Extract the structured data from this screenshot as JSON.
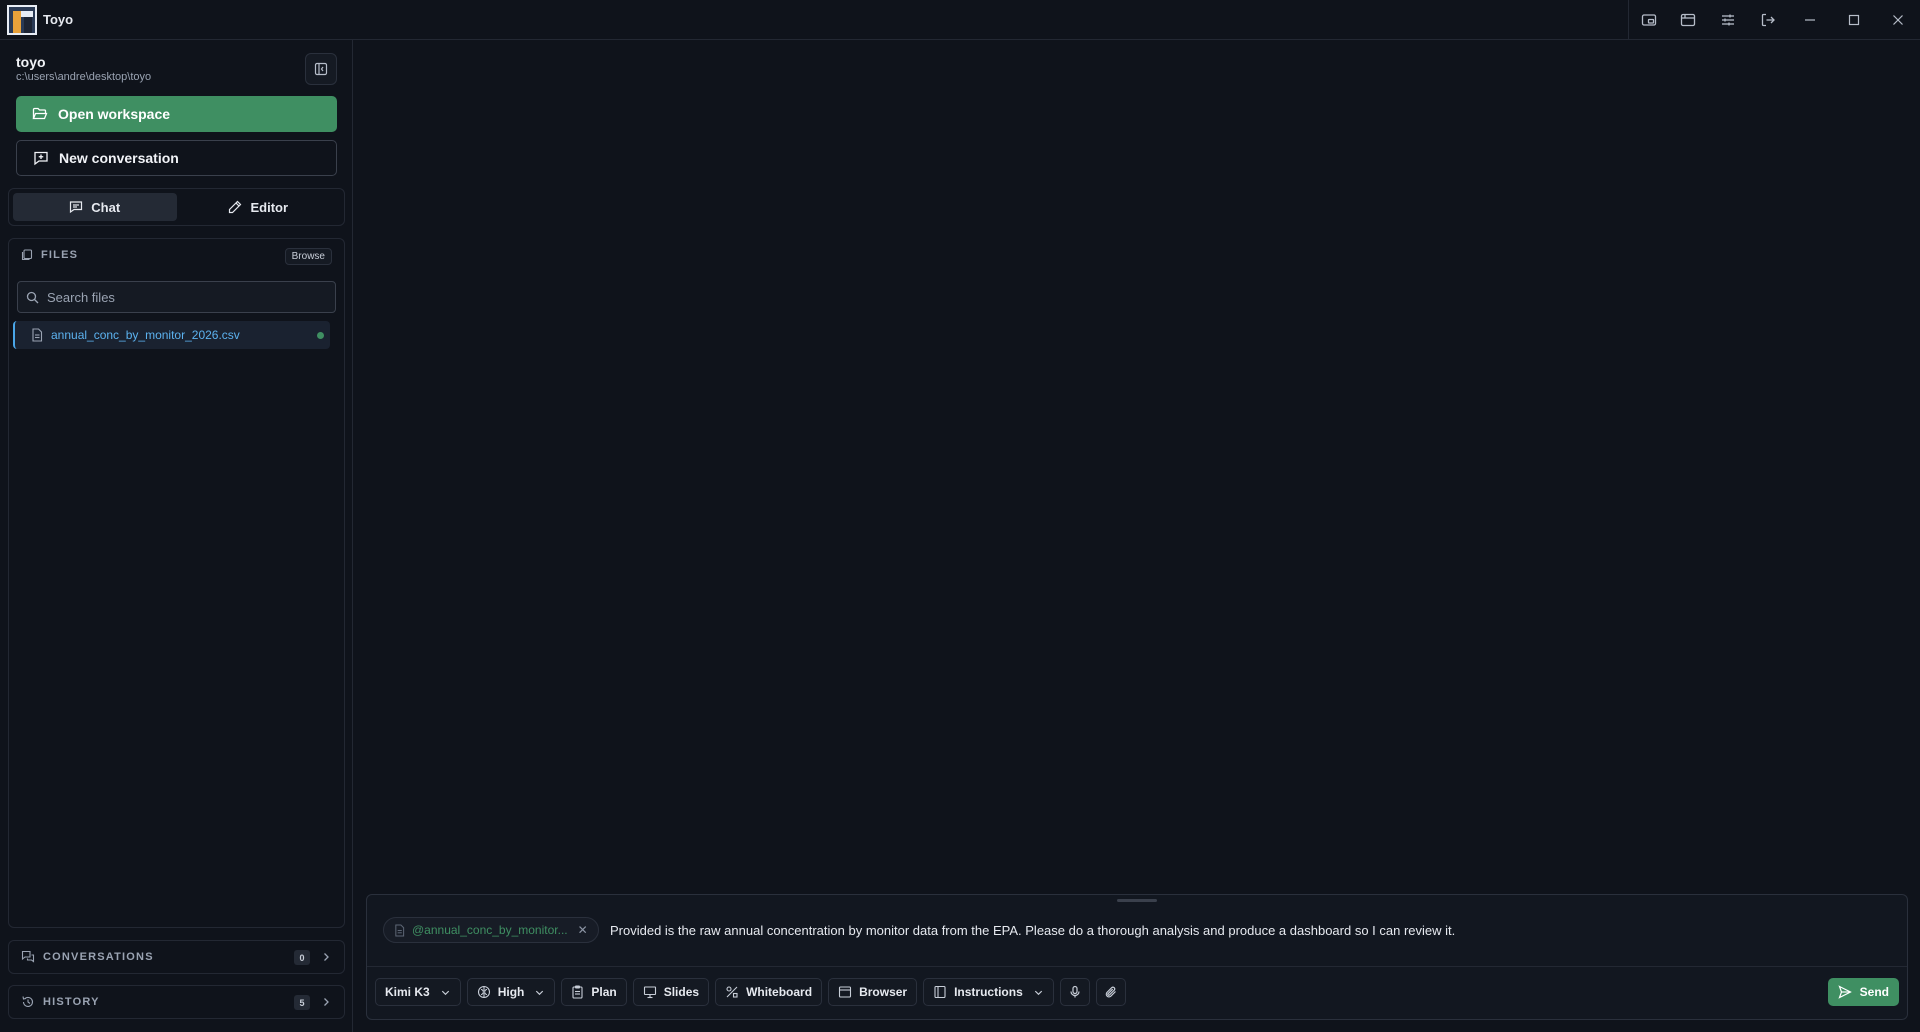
{
  "app": {
    "title": "Toyo"
  },
  "workspace": {
    "name": "toyo",
    "path": "c:\\users\\andre\\desktop\\toyo"
  },
  "sidebar": {
    "open_workspace_label": "Open workspace",
    "new_conversation_label": "New conversation",
    "tabs": [
      {
        "label": "Chat",
        "icon": "chat-icon",
        "active": true
      },
      {
        "label": "Editor",
        "icon": "pencil-icon",
        "active": false
      }
    ],
    "files": {
      "header": "FILES",
      "browse_label": "Browse",
      "search_placeholder": "Search files",
      "items": [
        {
          "name": "annual_conc_by_monitor_2026.csv",
          "selected": true
        }
      ]
    },
    "conversations": {
      "label": "CONVERSATIONS",
      "count": "0"
    },
    "history": {
      "label": "HISTORY",
      "count": "5"
    }
  },
  "composer": {
    "attached_file": "@annual_conc_by_monitor...",
    "text": "Provided is the raw annual concentration by monitor data from the EPA. Please do a thorough analysis and produce a dashboard so I can review it.",
    "toolbar": {
      "model": "Kimi K3",
      "effort": "High",
      "plan": "Plan",
      "slides": "Slides",
      "whiteboard": "Whiteboard",
      "browser": "Browser",
      "instructions": "Instructions",
      "send": "Send"
    }
  },
  "colors": {
    "accent": "#3f8f62",
    "link": "#5cb2ef",
    "background": "#0f131b"
  }
}
